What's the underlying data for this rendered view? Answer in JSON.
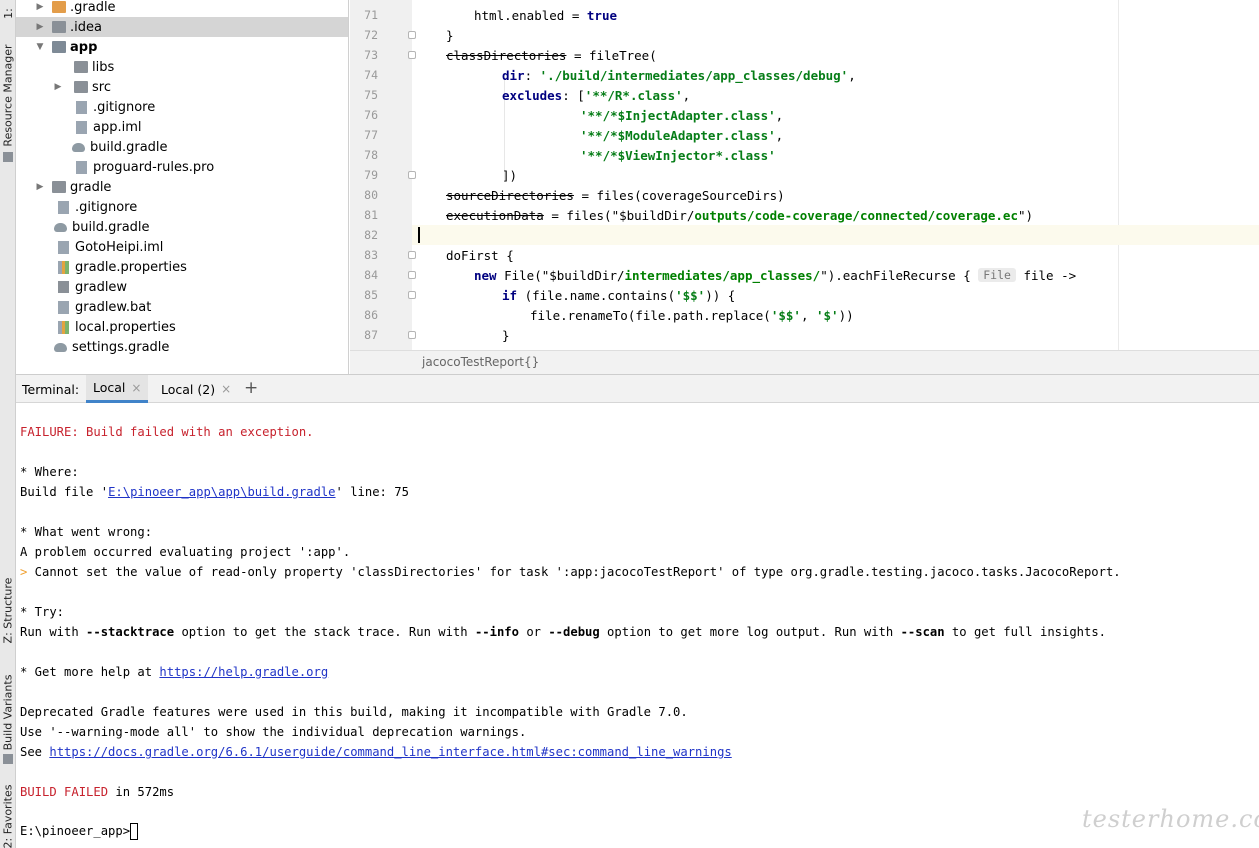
{
  "tool_strip": {
    "top_tab": "1:",
    "resource_manager": "Resource Manager",
    "structure": "Z: Structure",
    "build_variants": "Build Variants",
    "favorites": "2: Favorites"
  },
  "tree": {
    "items": [
      {
        "label": ".gradle",
        "arrow": "▶",
        "icon": "folder-orange-icon"
      },
      {
        "label": ".idea",
        "arrow": "▶",
        "icon": "folder-icon"
      },
      {
        "label": "app",
        "arrow": "▼",
        "icon": "module-folder-icon"
      },
      {
        "label": "libs",
        "arrow": "",
        "icon": "folder-icon"
      },
      {
        "label": "src",
        "arrow": "▶",
        "icon": "folder-icon"
      },
      {
        "label": ".gitignore",
        "arrow": "",
        "icon": "gitignore-file-icon"
      },
      {
        "label": "app.iml",
        "arrow": "",
        "icon": "iml-file-icon"
      },
      {
        "label": "build.gradle",
        "arrow": "",
        "icon": "gradle-file-icon"
      },
      {
        "label": "proguard-rules.pro",
        "arrow": "",
        "icon": "text-file-icon"
      },
      {
        "label": "gradle",
        "arrow": "▶",
        "icon": "folder-icon"
      },
      {
        "label": ".gitignore",
        "arrow": "",
        "icon": "gitignore-file-icon"
      },
      {
        "label": "build.gradle",
        "arrow": "",
        "icon": "gradle-file-icon"
      },
      {
        "label": "GotoHeipi.iml",
        "arrow": "",
        "icon": "iml-file-icon"
      },
      {
        "label": "gradle.properties",
        "arrow": "",
        "icon": "properties-file-icon"
      },
      {
        "label": "gradlew",
        "arrow": "",
        "icon": "shell-file-icon"
      },
      {
        "label": "gradlew.bat",
        "arrow": "",
        "icon": "bat-file-icon"
      },
      {
        "label": "local.properties",
        "arrow": "",
        "icon": "properties-file-icon"
      },
      {
        "label": "settings.gradle",
        "arrow": "",
        "icon": "gradle-file-icon"
      }
    ]
  },
  "editor": {
    "line_numbers": [
      "71",
      "72",
      "73",
      "74",
      "75",
      "76",
      "77",
      "78",
      "79",
      "80",
      "81",
      "82",
      "83",
      "84",
      "85",
      "86",
      "87"
    ],
    "lines": {
      "l71": {
        "a": "html.enabled = ",
        "b": "true"
      },
      "l72": {
        "a": "}"
      },
      "l73": {
        "a": "classDirectories",
        "b": " = fileTree("
      },
      "l74": {
        "a": "dir",
        "b": ": ",
        "c": "'./build/intermediates/app_classes/debug'",
        "d": ","
      },
      "l75": {
        "a": "excludes",
        "b": ": [",
        "c": "'**/R*.class'",
        "d": ","
      },
      "l76": {
        "a": "'**/*$InjectAdapter.class'",
        "b": ","
      },
      "l77": {
        "a": "'**/*$ModuleAdapter.class'",
        "b": ","
      },
      "l78": {
        "a": "'**/*$ViewInjector*.class'"
      },
      "l79": {
        "a": "])"
      },
      "l80": {
        "a": "sourceDirectories",
        "b": " = files(coverageSourceDirs)"
      },
      "l81": {
        "a": "executionData",
        "b": " = files(",
        "c": "\"$buildDir/",
        "d": "outputs/code-coverage/connected/coverage.ec",
        "e": "\")"
      },
      "l83": {
        "a": "doFirst {"
      },
      "l84": {
        "a": "new",
        "b": " File(",
        "c": "\"$buildDir/",
        "d": "intermediates/app_classes/",
        "e": "\"",
        "f": ").eachFileRecurse { ",
        "hint": "File",
        "g": " file ->"
      },
      "l85": {
        "a": "if",
        "b": " (file.name.contains(",
        "c": "'$$'",
        "d": ")) {"
      },
      "l86": {
        "a": "file.renameTo(file.path.replace(",
        "b": "'$$'",
        "c": ", ",
        "d": "'$'",
        "e": "))"
      },
      "l87": {
        "a": "}"
      }
    },
    "breadcrumb": "jacocoTestReport{}"
  },
  "terminal": {
    "title": "Terminal:",
    "tabs": [
      {
        "label": "Local"
      },
      {
        "label": "Local (2)"
      }
    ],
    "close_glyph": "×",
    "add_glyph": "+",
    "lines": {
      "failure": "FAILURE: Build failed with an exception.",
      "where": "* Where:",
      "build_file_pre": "Build file '",
      "build_file_path": "E:\\pinoeer_app\\app\\build.gradle",
      "build_file_post": "' line: 75",
      "what_wrong": "* What went wrong:",
      "problem": "A problem occurred evaluating project ':app'.",
      "cannot_marker": ">",
      "cannot": " Cannot set the value of read-only property 'classDirectories' for task ':app:jacocoTestReport' of type org.gradle.testing.jacoco.tasks.JacocoReport.",
      "try": "* Try:",
      "run_parts": [
        "Run with ",
        "--stacktrace",
        " option to get the stack trace. Run with ",
        "--info",
        " or ",
        "--debug",
        " option to get more log output. Run with ",
        "--scan",
        " to get full insights."
      ],
      "help_pre": "* Get more help at ",
      "help_link": "https://help.gradle.org",
      "deprecated": "Deprecated Gradle features were used in this build, making it incompatible with Gradle 7.0.",
      "warning_mode": "Use '--warning-mode all' to show the individual deprecation warnings.",
      "see_pre": "See ",
      "see_link": "https://docs.gradle.org/6.6.1/userguide/command_line_interface.html#sec:command_line_warnings",
      "build_failed": "BUILD FAILED",
      "build_failed_time": " in 572ms",
      "prompt": "E:\\pinoeer_app>"
    }
  },
  "watermark": "testerhome.com"
}
